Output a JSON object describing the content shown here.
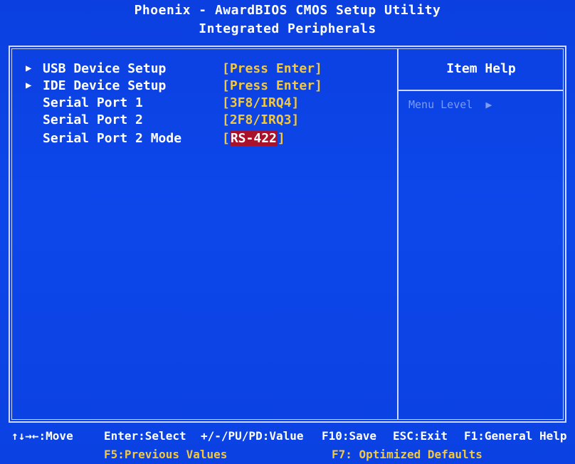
{
  "header": {
    "title": "Phoenix - AwardBIOS CMOS Setup Utility",
    "subtitle": "Integrated Peripherals"
  },
  "menu": {
    "items": [
      {
        "label": "USB Device Setup",
        "value": "[Press Enter]",
        "submenu": true
      },
      {
        "label": "IDE Device Setup",
        "value": "[Press Enter]",
        "submenu": true
      },
      {
        "label": "Serial Port 1",
        "value": "[3F8/IRQ4]",
        "submenu": false
      },
      {
        "label": "Serial Port 2",
        "value": "[2F8/IRQ3]",
        "submenu": false
      },
      {
        "label": "Serial Port 2 Mode",
        "value_open": "[",
        "value_selected": "RS-422",
        "value_close": "]",
        "submenu": false,
        "selected": true
      }
    ]
  },
  "help": {
    "title": "Item Help",
    "menu_level_label": "Menu Level",
    "menu_level_arrow": "▶"
  },
  "footer": {
    "move": "↑↓→←:Move",
    "select": "Enter:Select",
    "value": "+/-/PU/PD:Value",
    "save": "F10:Save",
    "exit": "ESC:Exit",
    "general_help": "F1:General Help",
    "previous_values": "F5:Previous Values",
    "optimized_defaults": "F7: Optimized Defaults"
  },
  "colors": {
    "background": "#0c44e8",
    "value_yellow": "#f3c83c",
    "selection_red": "#a8122a",
    "border": "#cfd8ff"
  },
  "icons": {
    "submenu": "triangle-right-icon"
  }
}
